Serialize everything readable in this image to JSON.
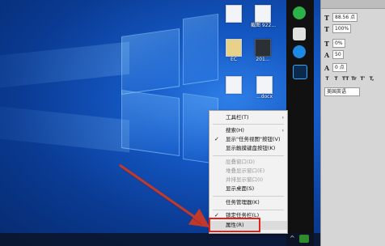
{
  "desktop": {
    "icons": [
      {
        "label": "",
        "dark": false
      },
      {
        "label": "截图\n922...",
        "dark": false
      },
      {
        "label": "",
        "dark": false
      },
      {
        "label": "EC",
        "dark": false
      },
      {
        "label": "201...",
        "dark": true
      },
      {
        "label": "",
        "dark": false
      },
      {
        "label": "...docx",
        "dark": false
      }
    ]
  },
  "ps_panel": {
    "font_size": "88.56 点",
    "leading": "100%",
    "tracking": "0%",
    "kerning": "50",
    "baseline": "0 点",
    "language": "美国英语",
    "style_buttons": [
      "T",
      "T",
      "TT",
      "Tr",
      "T'",
      "T,",
      "T",
      "T"
    ]
  },
  "context_menu": {
    "items": [
      {
        "label": "工具栏(T)",
        "arrow": true,
        "disabled": false,
        "check": false
      },
      {
        "label": "搜索(H)",
        "arrow": true,
        "disabled": false,
        "check": false
      },
      {
        "label": "显示\"任务视图\"按钮(V)",
        "arrow": false,
        "disabled": false,
        "check": true
      },
      {
        "label": "显示触摸键盘按钮(K)",
        "arrow": false,
        "disabled": false,
        "check": false
      },
      {
        "label": "层叠窗口(D)",
        "arrow": false,
        "disabled": true,
        "check": false
      },
      {
        "label": "堆叠显示窗口(E)",
        "arrow": false,
        "disabled": true,
        "check": false
      },
      {
        "label": "并排显示窗口(I)",
        "arrow": false,
        "disabled": true,
        "check": false
      },
      {
        "label": "显示桌面(S)",
        "arrow": false,
        "disabled": false,
        "check": false
      },
      {
        "label": "任务管理器(K)",
        "arrow": false,
        "disabled": false,
        "check": false
      },
      {
        "label": "锁定任务栏(L)",
        "arrow": false,
        "disabled": false,
        "check": true
      },
      {
        "label": "属性(R)",
        "arrow": false,
        "disabled": false,
        "check": false,
        "highlighted": true
      }
    ]
  },
  "colors": {
    "highlight_box": "#e0241b",
    "arrow": "#c0392b"
  }
}
